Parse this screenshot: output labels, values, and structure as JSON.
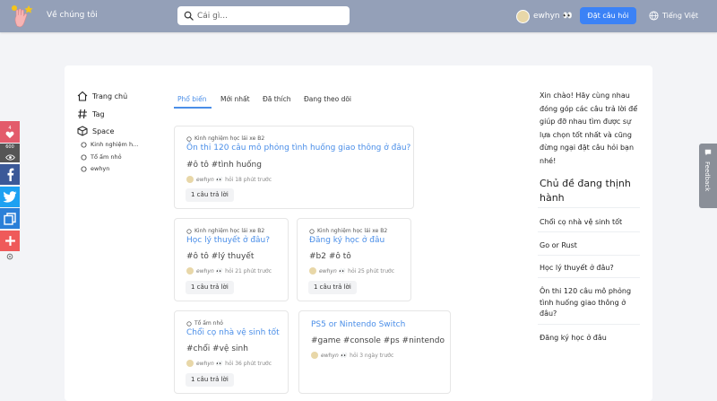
{
  "header": {
    "about": "Về chúng tôi",
    "search_placeholder": "Cái gì...",
    "user_name": "ewhyn 👀",
    "ask_button": "Đặt câu hỏi",
    "language": "Tiếng Việt"
  },
  "nav": {
    "home": "Trang chủ",
    "tag": "Tag",
    "space": "Space",
    "spaces": [
      "Kinh nghiệm h...",
      "Tổ ấm nhỏ",
      "ewhyn"
    ]
  },
  "tabs": [
    "Phổ biến",
    "Mới nhất",
    "Đã thích",
    "Đang theo dõi"
  ],
  "questions": [
    {
      "space": "Kinh nghiệm học lái xe B2",
      "title": "Ôn thi 120 câu mô phỏng tình huống giao thông ở đâu?",
      "tags": "#ô tô #tình huống",
      "author": "ewhyn 👀",
      "time": "hỏi 18 phút trước",
      "answers": "1 câu trả lời"
    },
    {
      "space": "Kinh nghiệm học lái xe B2",
      "title": "Học lý thuyết ở đâu?",
      "tags": "#ô tô #lý thuyết",
      "author": "ewhyn 👀",
      "time": "hỏi 21 phút trước",
      "answers": "1 câu trả lời"
    },
    {
      "space": "Kinh nghiệm học lái xe B2",
      "title": "Đăng ký học ở đâu",
      "tags": "#b2 #ô tô",
      "author": "ewhyn 👀",
      "time": "hỏi 25 phút trước",
      "answers": "1 câu trả lời"
    },
    {
      "space": "Tổ ấm nhỏ",
      "title": "Chổi cọ nhà vệ sinh tốt",
      "tags": "#chổi #vệ sinh",
      "author": "ewhyn 👀",
      "time": "hỏi 36 phút trước",
      "answers": "1 câu trả lời"
    },
    {
      "space": "",
      "title": "PS5 or Nintendo Switch",
      "tags": "#game #console #ps #nintendo",
      "author": "ewhyn 👀",
      "time": "hỏi 3 ngày trước",
      "answers": ""
    }
  ],
  "sidebar": {
    "welcome": "Xin chào! Hãy cùng nhau đóng góp các câu trả lời để giúp đỡ nhau tìm được sự lựa chọn tốt nhất và cũng đừng ngại đặt câu hỏi bạn nhé!",
    "topics_title": "Chủ đề đang thịnh hành",
    "topics": [
      "Chổi cọ nhà vệ sinh tốt",
      "Go or Rust",
      "Học lý thuyết ở đâu?",
      "Ôn thi 120 câu mô phỏng tình huống giao thông ở đâu?",
      "Đăng ký học ở đâu"
    ]
  },
  "share": {
    "likes": "4",
    "views": "600"
  },
  "feedback": "Feedback",
  "colors": {
    "header_bg": "#94a0b8",
    "accent": "#3b82f6",
    "link": "#4a8ee8",
    "facebook": "#3b5998",
    "twitter": "#1da1f2",
    "copy": "#2a7fd8",
    "more": "#ef5a5a",
    "like": "#e35b6b"
  }
}
